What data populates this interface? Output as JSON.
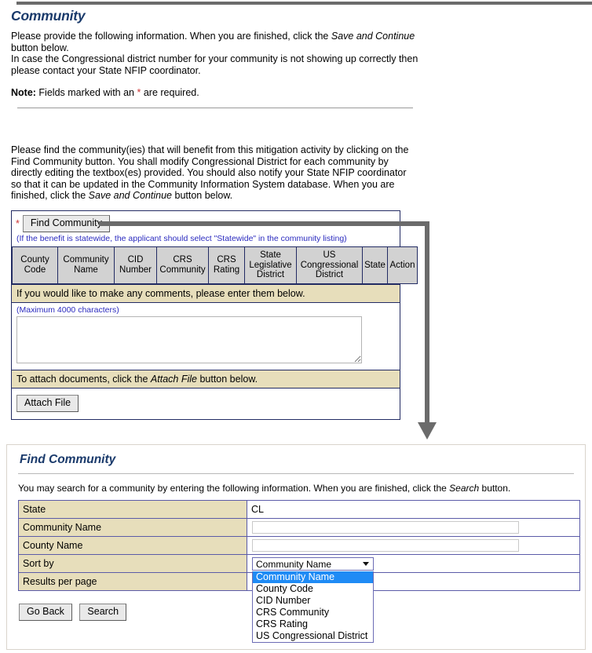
{
  "page": {
    "title": "Community",
    "intro_1": "Please provide the following information. When you are finished, click the ",
    "intro_1_ital": "Save and Continue",
    "intro_1_end": " button below.",
    "intro_2": "In case the Congressional district number for your community is not showing up correctly then please contact your State NFIP coordinator.",
    "note_label": "Note:",
    "note_text_a": " Fields marked with an ",
    "note_star": "*",
    "note_text_b": " are required.",
    "find_paragraph_a": "Please find the community(ies) that will benefit from this mitigation activity by clicking on the Find Community button. You shall modify Congressional District for each community by directly editing the textbox(es) provided. You should also notify your State NFIP coordinator so that it can be updated in the Community Information System database. When you are finished, click the ",
    "find_paragraph_ital": "Save and Continue",
    "find_paragraph_b": " button below."
  },
  "community_panel": {
    "required_star": "*",
    "find_community_button": "Find Community",
    "statewide_note": "(If the benefit is statewide, the applicant should select \"Statewide\" in the community listing)",
    "table_headers": [
      "County Code",
      "Community Name",
      "CID Number",
      "CRS Community",
      "CRS Rating",
      "State Legislative District",
      "US Congressional District",
      "State",
      "Action"
    ],
    "comments_prompt": "If you would like to make any comments, please enter them below.",
    "max_chars_note": "(Maximum 4000 characters)",
    "comments_value": "",
    "attach_prompt_a": "To attach documents, click the ",
    "attach_prompt_ital": "Attach File",
    "attach_prompt_b": " button below.",
    "attach_file_button": "Attach File"
  },
  "find_community_panel": {
    "title": "Find Community",
    "description_a": "You may search for a community by entering the following information. When you are finished, click the ",
    "description_ital": "Search",
    "description_b": " button.",
    "rows": {
      "state_label": "State",
      "state_value": "CL",
      "community_name_label": "Community Name",
      "community_name_value": "",
      "county_name_label": "County Name",
      "county_name_value": "",
      "sort_by_label": "Sort by",
      "sort_by_value": "Community Name",
      "results_per_page_label": "Results per page",
      "results_per_page_value": ""
    },
    "sort_options": [
      "Community Name",
      "County Code",
      "CID Number",
      "CRS Community",
      "CRS Rating",
      "US Congressional District"
    ],
    "selected_sort_index": 0,
    "go_back_button": "Go Back",
    "search_button": "Search"
  },
  "colors": {
    "heading": "#1a3a6b",
    "tan_row": "#e7debb",
    "header_gray": "#d2d2d2",
    "table_border": "#222b63",
    "panel_border": "#5b5ba8",
    "highlight": "#1f8bf5",
    "arrow": "#6b6b6b",
    "note_blue": "#2b2bbf",
    "required_star": "#cc3333"
  }
}
